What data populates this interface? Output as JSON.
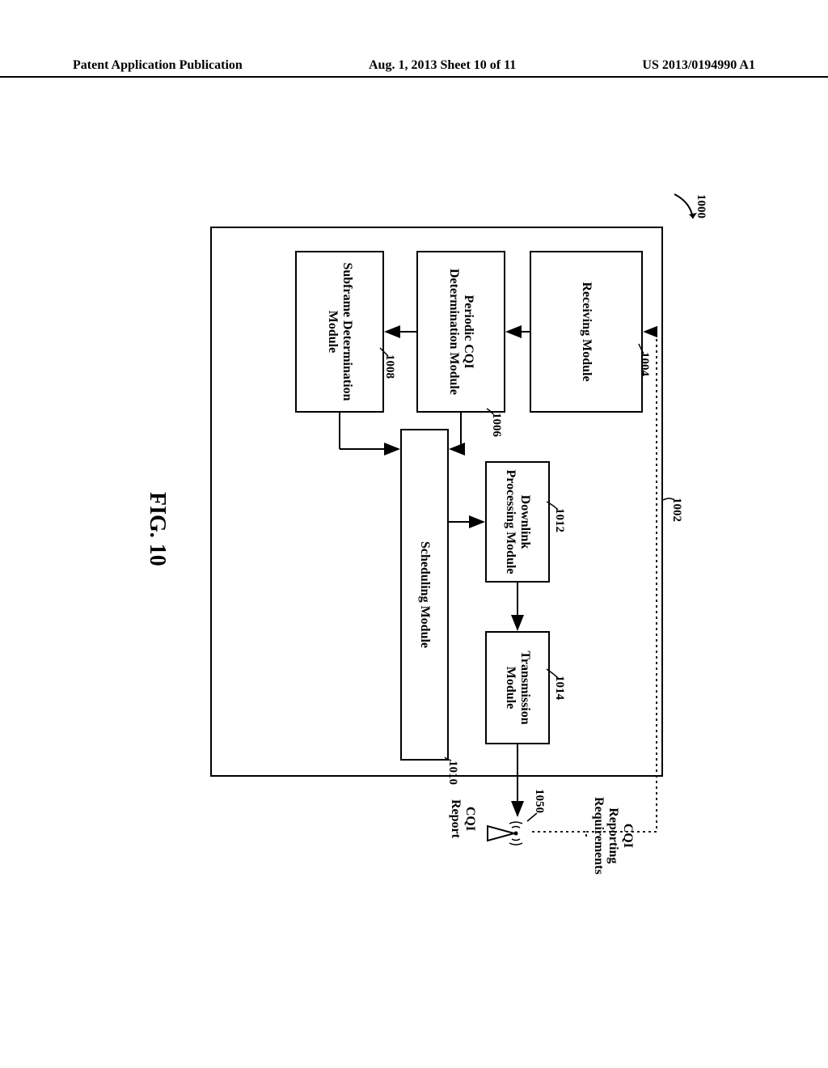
{
  "header": {
    "left": "Patent Application Publication",
    "center": "Aug. 1, 2013  Sheet 10 of 11",
    "right": "US 2013/0194990 A1"
  },
  "figure_label": "FIG. 10",
  "refs": {
    "r1000": "1000",
    "r1002": "1002",
    "r1004": "1004",
    "r1006": "1006",
    "r1008": "1008",
    "r1010": "1010",
    "r1012": "1012",
    "r1014": "1014",
    "r1050": "1050"
  },
  "modules": {
    "receiving": "Receiving Module",
    "periodic": "Periodic CQI Determination Module",
    "subframe": "Subframe Determination Module",
    "scheduling": "Scheduling Module",
    "downlink": "Downlink Processing Module",
    "transmission": "Transmission Module"
  },
  "signals": {
    "cqi_req_line1": "CQI",
    "cqi_req_line2": "Reporting",
    "cqi_req_line3": "Requirements",
    "cqi_rep_line1": "CQI",
    "cqi_rep_line2": "Report"
  }
}
